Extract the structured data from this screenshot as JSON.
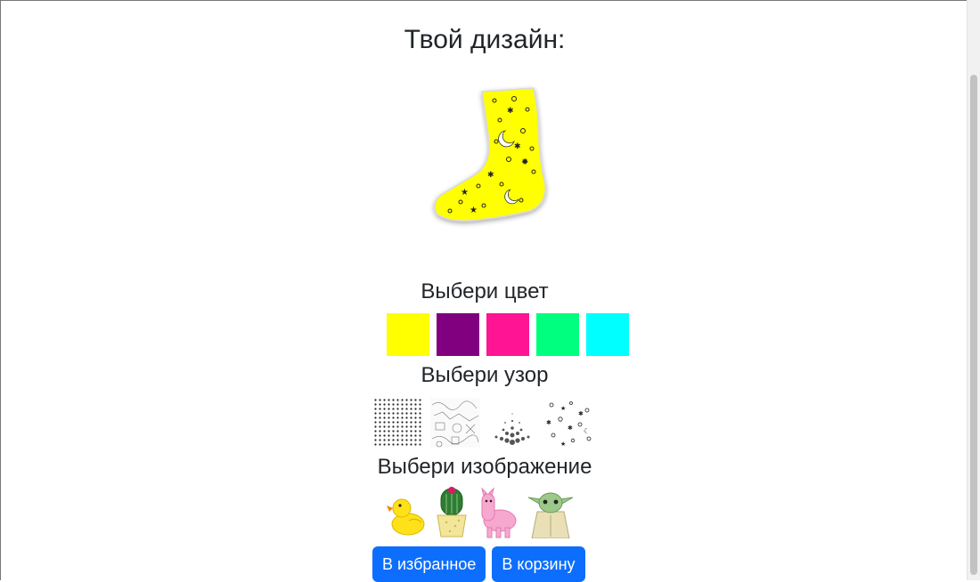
{
  "design": {
    "title": "Твой дизайн:"
  },
  "sections": {
    "color_title": "Выбери цвет",
    "pattern_title": "Выбери узор",
    "image_title": "Выбери изображение"
  },
  "colors": [
    "#ffff00",
    "#800080",
    "#ff1493",
    "#00ff7f",
    "#00ffff"
  ],
  "selected_color": "#ffff00",
  "patterns": [
    "dots-grid",
    "doodle-lines",
    "halftone-hexagons",
    "stars-moons"
  ],
  "selected_pattern": "stars-moons",
  "images": [
    "duck",
    "cactus",
    "llama",
    "baby-yoda"
  ],
  "buttons": {
    "favorite": "В избранное",
    "cart": "В корзину"
  }
}
